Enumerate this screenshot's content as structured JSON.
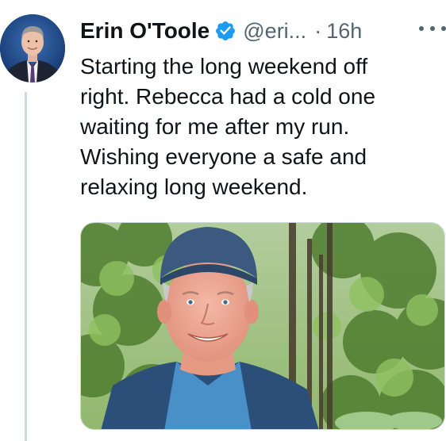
{
  "tweet": {
    "author_name": "Erin O'Toole",
    "handle": "@eri...",
    "separator": "·",
    "time": "16h",
    "text": "Starting the long weekend off\nright. Rebecca had a cold one\nwaiting for me after my run.\nWishing everyone a safe and\nrelaxing long weekend.",
    "verified": true
  },
  "icons": {
    "verified": "verified-badge-icon",
    "more": "more-options-icon"
  },
  "colors": {
    "primary_text": "#0f1419",
    "secondary_text": "#536471",
    "verified_blue": "#1d9bf0",
    "thread_line": "#cfd9de"
  }
}
